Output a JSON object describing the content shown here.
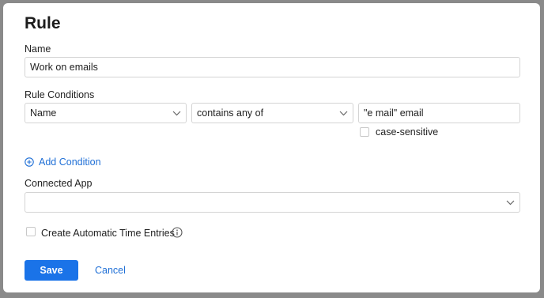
{
  "dialog": {
    "title": "Rule",
    "name_label": "Name",
    "name_value": "Work on emails",
    "conditions_label": "Rule Conditions",
    "condition": {
      "field": "Name",
      "operator": "contains any of",
      "value": "\"e mail\" email",
      "case_sensitive_label": "case-sensitive"
    },
    "add_condition_label": "Add Condition",
    "connected_app_label": "Connected App",
    "connected_app_value": "",
    "auto_time_label": "Create Automatic Time Entries",
    "save_label": "Save",
    "cancel_label": "Cancel"
  },
  "colors": {
    "accent": "#1a73e8",
    "link": "#1f6fd6",
    "backdrop": "#8a8a8a"
  },
  "icons": [
    "chevron-down-icon",
    "plus-circle-icon",
    "info-icon"
  ]
}
